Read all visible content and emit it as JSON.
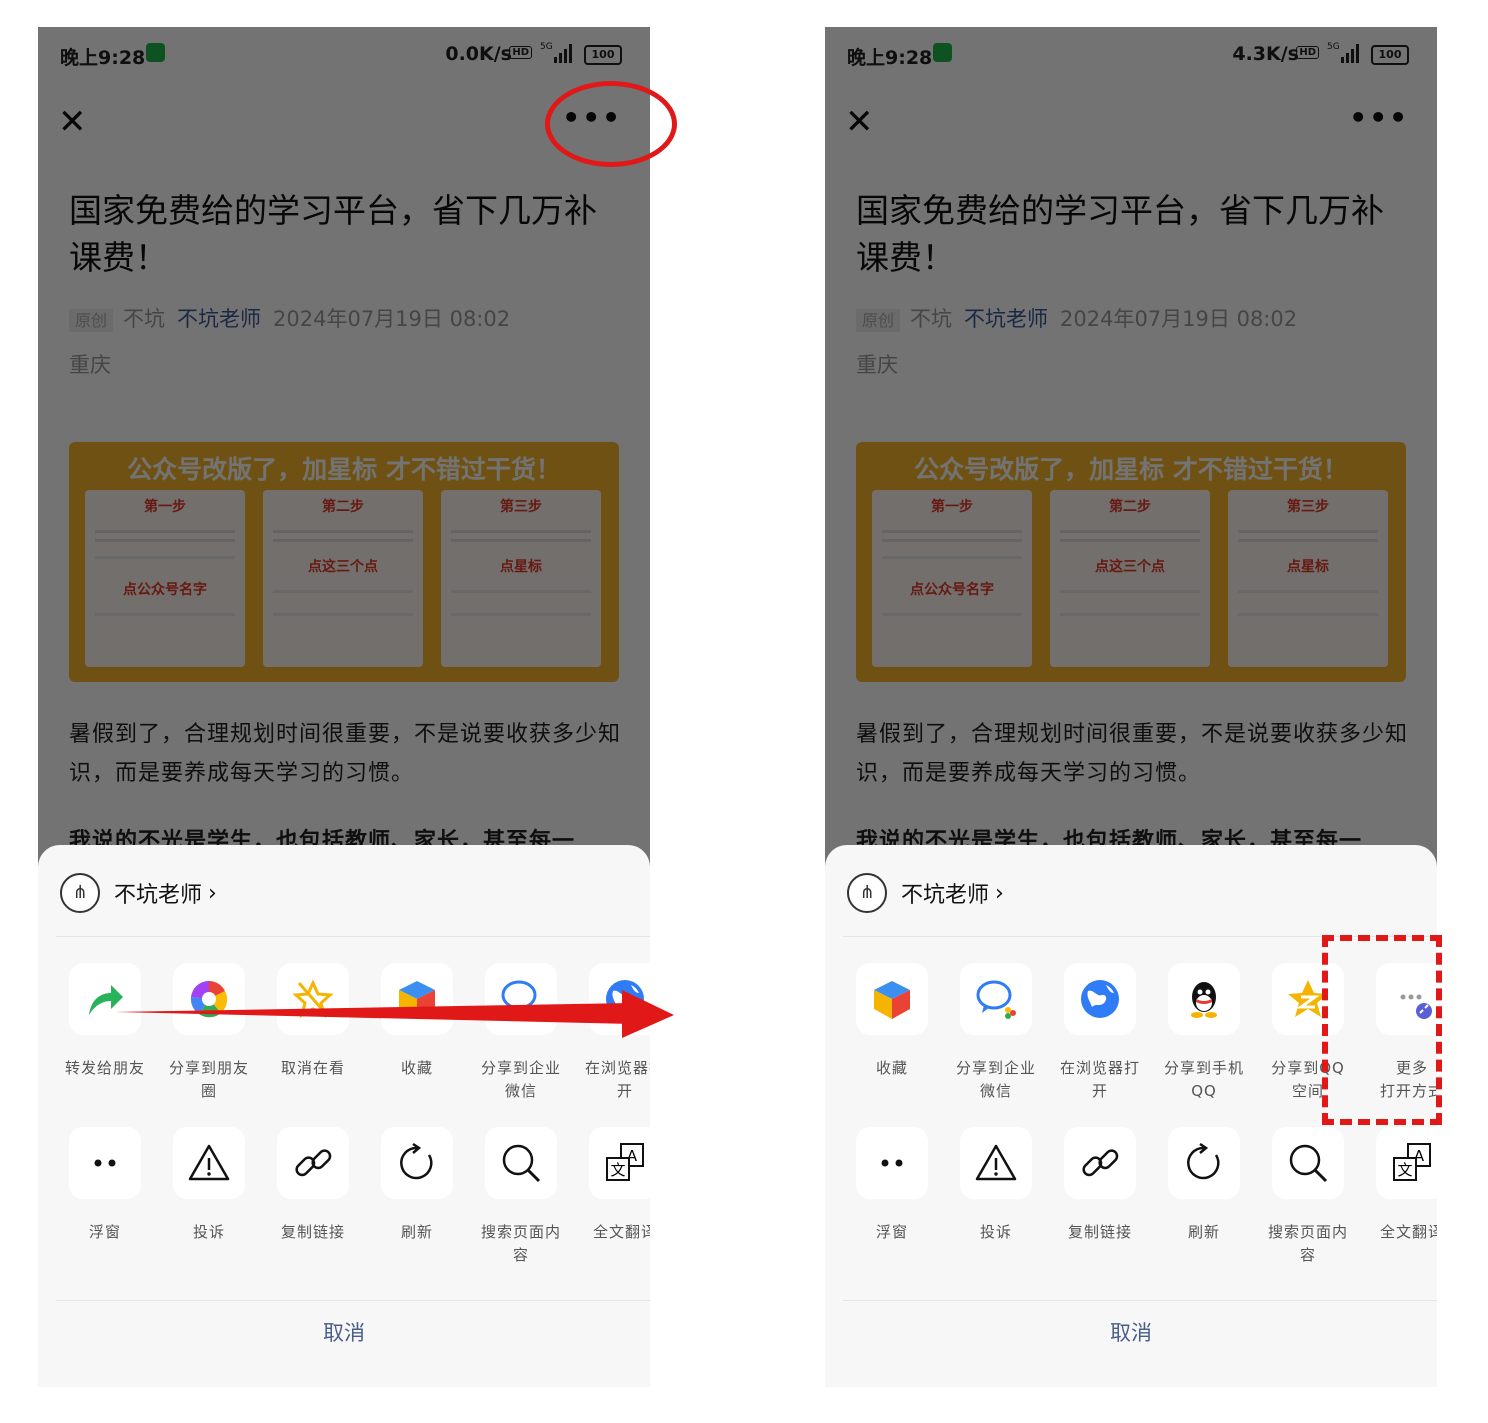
{
  "left": {
    "status": {
      "time": "晚上9:28",
      "speed": "0.0K/s",
      "hd": "HD",
      "network": "5G",
      "battery": "100"
    },
    "title": "国家免费给的学习平台，省下几万补课费！",
    "meta": {
      "original": "原创",
      "source": "不坑",
      "author": "不坑老师",
      "date": "2024年07月19日 08:02"
    },
    "location": "重庆",
    "banner": {
      "title": "公众号改版了，加星标 才不错过干货！",
      "steps": [
        "第一步",
        "第二步",
        "第三步"
      ],
      "hints": [
        "点公众号名字",
        "点这三个点",
        "点星标"
      ]
    },
    "paragraph": "暑假到了，合理规划时间很重要，不是说要收获多少知识，而是要养成每天学习的习惯。",
    "paragraph2": "我说的不光是学生，也包括教师、家长，甚至每一",
    "sheet": {
      "account": "不坑老师",
      "row1": [
        {
          "icon": "forward-arrow-icon",
          "label": "转发给朋友"
        },
        {
          "icon": "moments-icon",
          "label": "分享到朋友\n圈"
        },
        {
          "icon": "cancel-watching-icon",
          "label": "取消在看"
        },
        {
          "icon": "favorite-cube-icon",
          "label": "收藏"
        },
        {
          "icon": "wecom-icon",
          "label": "分享到企业\n微信"
        },
        {
          "icon": "browser-globe-icon",
          "label": "在浏览器打\n开"
        }
      ],
      "row2": [
        {
          "icon": "floating-window-icon",
          "label": "浮窗"
        },
        {
          "icon": "warning-icon",
          "label": "投诉"
        },
        {
          "icon": "link-icon",
          "label": "复制链接"
        },
        {
          "icon": "refresh-icon",
          "label": "刷新"
        },
        {
          "icon": "search-icon",
          "label": "搜索页面内\n容"
        },
        {
          "icon": "translate-icon",
          "label": "全文翻译"
        }
      ],
      "cancel": "取消"
    }
  },
  "right": {
    "status": {
      "time": "晚上9:28",
      "speed": "4.3K/s",
      "hd": "HD",
      "network": "5G",
      "battery": "100"
    },
    "title": "国家免费给的学习平台，省下几万补课费！",
    "meta": {
      "original": "原创",
      "source": "不坑",
      "author": "不坑老师",
      "date": "2024年07月19日 08:02"
    },
    "location": "重庆",
    "banner": {
      "title": "公众号改版了，加星标 才不错过干货！",
      "steps": [
        "第一步",
        "第二步",
        "第三步"
      ],
      "hints": [
        "点公众号名字",
        "点这三个点",
        "点星标"
      ]
    },
    "paragraph": "暑假到了，合理规划时间很重要，不是说要收获多少知识，而是要养成每天学习的习惯。",
    "paragraph2": "我说的不光是学生，也包括教师、家长，甚至每一",
    "sheet": {
      "account": "不坑老师",
      "row1": [
        {
          "icon": "favorite-cube-icon",
          "label": "收藏"
        },
        {
          "icon": "wecom-icon",
          "label": "分享到企业\n微信"
        },
        {
          "icon": "browser-globe-icon",
          "label": "在浏览器打\n开"
        },
        {
          "icon": "qq-penguin-icon",
          "label": "分享到手机\nQQ"
        },
        {
          "icon": "qzone-star-icon",
          "label": "分享到QQ\n空间"
        },
        {
          "icon": "more-open-icon",
          "label": "更多\n打开方式"
        }
      ],
      "row2": [
        {
          "icon": "floating-window-icon",
          "label": "浮窗"
        },
        {
          "icon": "warning-icon",
          "label": "投诉"
        },
        {
          "icon": "link-icon",
          "label": "复制链接"
        },
        {
          "icon": "refresh-icon",
          "label": "刷新"
        },
        {
          "icon": "search-icon",
          "label": "搜索页面内\n容"
        },
        {
          "icon": "translate-icon",
          "label": "全文翻译"
        }
      ],
      "cancel": "取消"
    }
  },
  "colors": {
    "annotation": "#e01818",
    "author": "#3c5a94",
    "banner": "#f7b52b",
    "overlay": "rgba(0,0,0,0.55)"
  }
}
